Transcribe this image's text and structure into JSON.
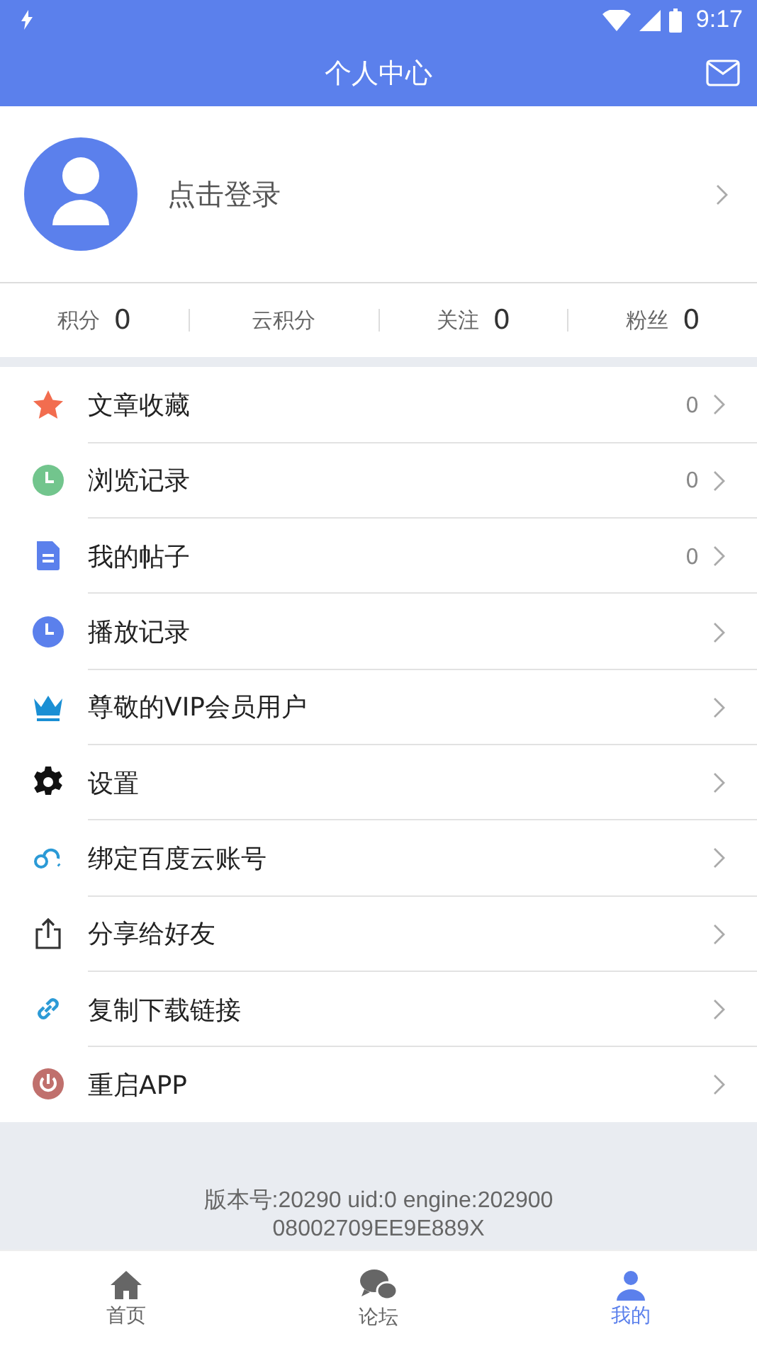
{
  "status_bar": {
    "time": "9:17"
  },
  "header": {
    "title": "个人中心"
  },
  "profile": {
    "login_text": "点击登录"
  },
  "stats": [
    {
      "label": "积分",
      "value": "0"
    },
    {
      "label": "云积分"
    },
    {
      "label": "关注",
      "value": "0"
    },
    {
      "label": "粉丝",
      "value": "0"
    }
  ],
  "menu": [
    {
      "kind": "star",
      "label": "文章收藏",
      "count": "0"
    },
    {
      "kind": "clock-green",
      "label": "浏览记录",
      "count": "0"
    },
    {
      "kind": "document",
      "label": "我的帖子",
      "count": "0"
    },
    {
      "kind": "clock-blue",
      "label": "播放记录"
    },
    {
      "kind": "crown",
      "label": "尊敬的VIP会员用户"
    },
    {
      "kind": "gear",
      "label": "设置"
    },
    {
      "kind": "cloud",
      "label": "绑定百度云账号"
    },
    {
      "kind": "share",
      "label": "分享给好友"
    },
    {
      "kind": "link",
      "label": "复制下载链接"
    },
    {
      "kind": "power",
      "label": "重启APP"
    }
  ],
  "version": "版本号:20290 uid:0 engine:202900 08002709EE9E889X",
  "tabs": [
    {
      "kind": "home",
      "label": "首页",
      "selected": false
    },
    {
      "kind": "forum",
      "label": "论坛",
      "selected": false
    },
    {
      "kind": "me",
      "label": "我的",
      "selected": true
    }
  ]
}
